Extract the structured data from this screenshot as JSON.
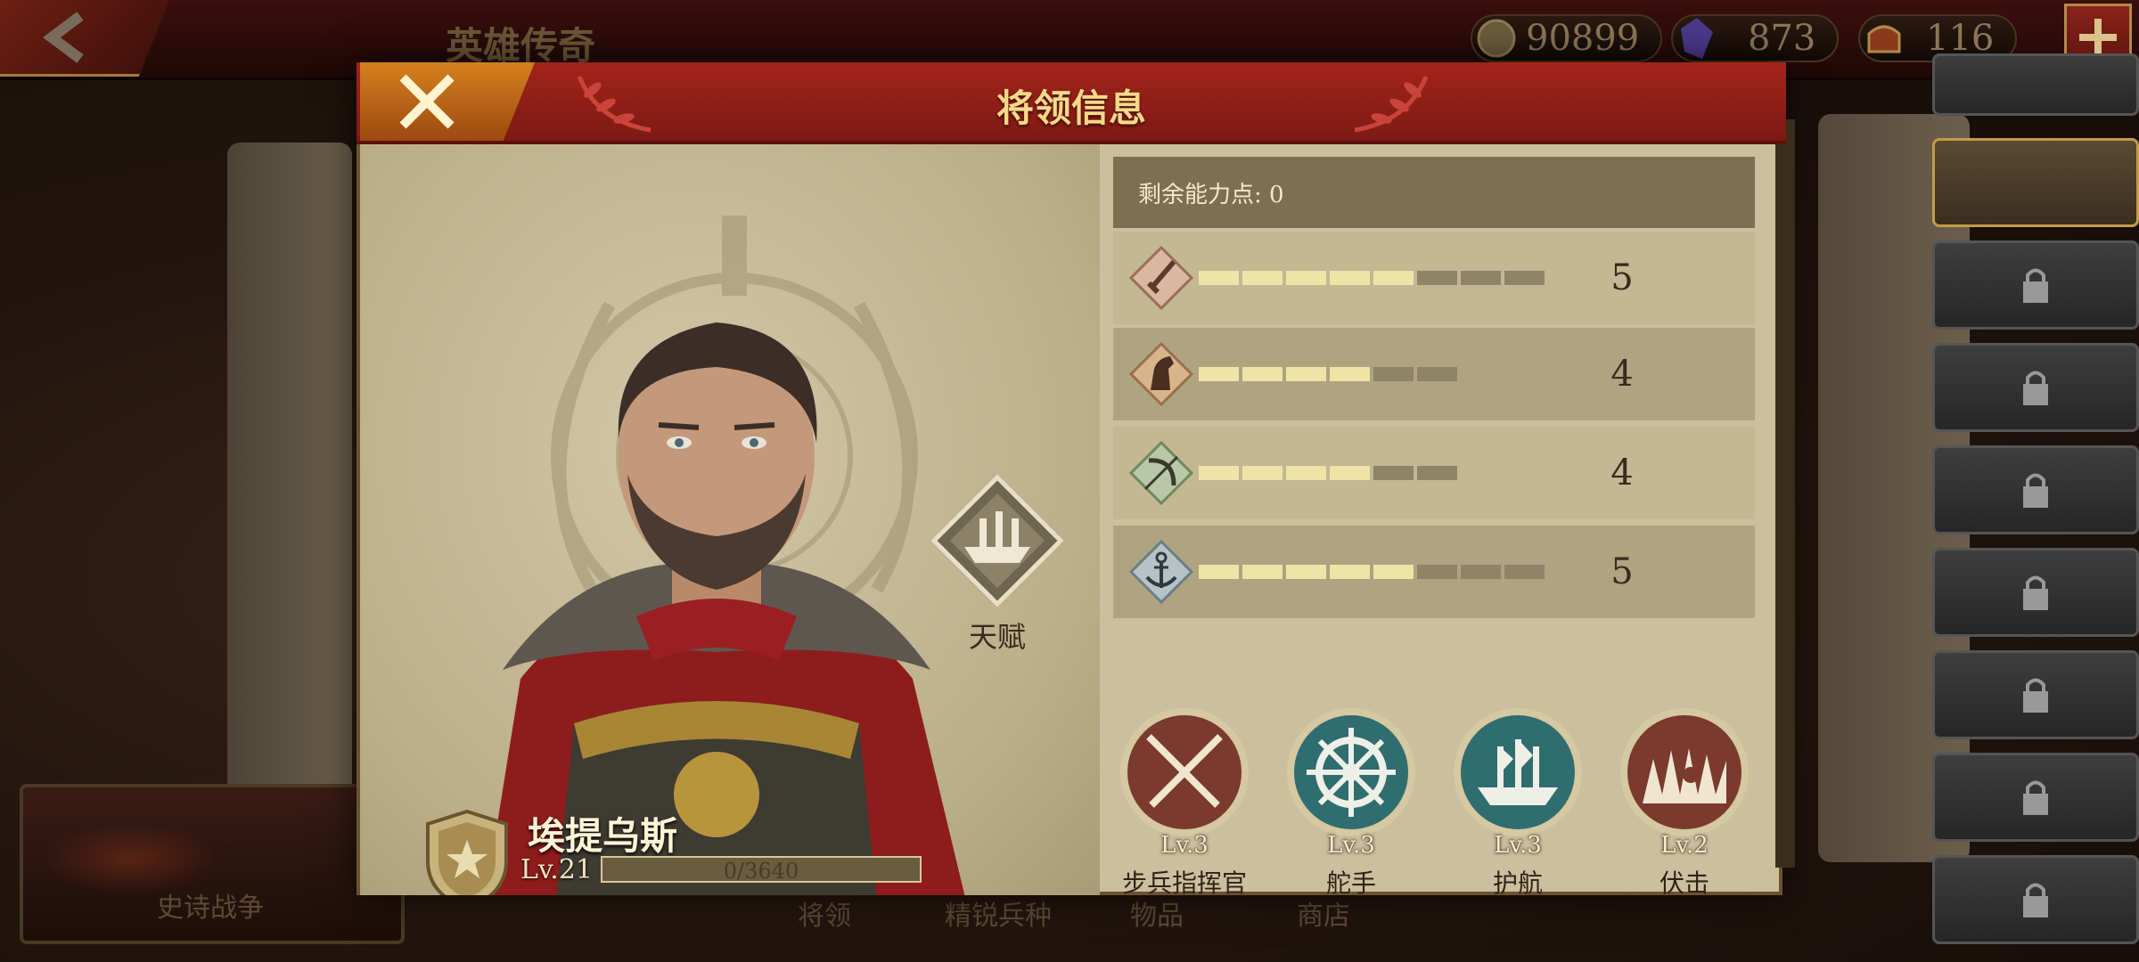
{
  "screen": {
    "title": "英雄传奇",
    "resources": [
      {
        "icon": "coin-icon",
        "value": "90899"
      },
      {
        "icon": "gem-icon",
        "value": "873"
      },
      {
        "icon": "helmet-icon",
        "value": "116"
      }
    ],
    "epic_war_label": "史诗战争",
    "bottom_tabs": [
      "将领",
      "精锐兵种",
      "物品",
      "商店"
    ]
  },
  "modal": {
    "title": "将领信息",
    "talent_label": "天赋",
    "hero": {
      "name": "埃提乌斯",
      "level": "Lv.21",
      "xp_text": "0/3640",
      "xp_fraction": 0.0
    },
    "points_label": "剩余能力点: 0",
    "stats": [
      {
        "icon": "sword-icon",
        "value": "5",
        "filled": 5,
        "max": 8
      },
      {
        "icon": "horse-icon",
        "value": "4",
        "filled": 4,
        "max": 6
      },
      {
        "icon": "bow-icon",
        "value": "4",
        "filled": 4,
        "max": 6
      },
      {
        "icon": "anchor-icon",
        "value": "5",
        "filled": 5,
        "max": 8
      }
    ],
    "skills": [
      {
        "icon": "crossed-swords-icon",
        "level": "Lv.3",
        "name": "步兵指挥官",
        "color": "#7a3a2e"
      },
      {
        "icon": "ship-wheel-icon",
        "level": "Lv.3",
        "name": "舵手",
        "color": "#2f6d70"
      },
      {
        "icon": "fleet-icon",
        "level": "Lv.3",
        "name": "护航",
        "color": "#2f6d70"
      },
      {
        "icon": "ambush-icon",
        "level": "Lv.2",
        "name": "伏击",
        "color": "#7a3a2e"
      }
    ]
  },
  "colors": {
    "header_red": "#a3241a",
    "close_orange": "#d4801f",
    "title_gold": "#f5d98a",
    "panel_tan": "#cbbf9f",
    "pip_on": "#efe3a8"
  }
}
